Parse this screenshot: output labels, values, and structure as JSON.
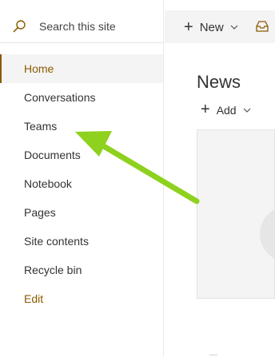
{
  "search": {
    "placeholder": "Search this site",
    "icon": "search-icon"
  },
  "nav": {
    "items": [
      {
        "label": "Home",
        "selected": true
      },
      {
        "label": "Conversations"
      },
      {
        "label": "Teams"
      },
      {
        "label": "Documents"
      },
      {
        "label": "Notebook"
      },
      {
        "label": "Pages"
      },
      {
        "label": "Site contents"
      },
      {
        "label": "Recycle bin"
      }
    ],
    "edit_label": "Edit"
  },
  "commandbar": {
    "new_label": "New",
    "mail_icon": "inbox-icon"
  },
  "news": {
    "title": "News",
    "add_label": "Add"
  },
  "colors": {
    "accent": "#8a5a00",
    "sidebar_selected_bg": "#f4f4f4",
    "annotation_arrow": "#8ed11f"
  }
}
